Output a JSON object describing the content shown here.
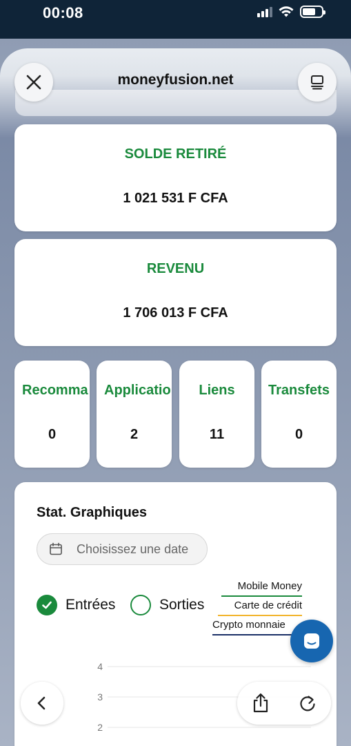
{
  "status_bar": {
    "time": "00:08"
  },
  "browser": {
    "site": "moneyfusion.net",
    "close_icon": "close-icon",
    "tabs_icon": "tab-overview-icon",
    "back_icon": "chevron-left-icon",
    "share_icon": "share-icon",
    "reload_icon": "reload-icon"
  },
  "cards": {
    "solde": {
      "label": "SOLDE RETIRÉ",
      "value": "1 021 531 F CFA"
    },
    "revenu": {
      "label": "REVENU",
      "value": "1 706 013 F CFA"
    }
  },
  "stats": [
    {
      "label": "Recomma",
      "value": "0"
    },
    {
      "label": "Applicatio",
      "value": "2"
    },
    {
      "label": "Liens",
      "value": "11"
    },
    {
      "label": "Transfets",
      "value": "0"
    }
  ],
  "chart_panel": {
    "title": "Stat. Graphiques",
    "date_placeholder": "Choisissez une date",
    "radio_in": "Entrées",
    "radio_out": "Sorties",
    "legend": [
      {
        "name": "Mobile Money",
        "color": "#1a8a3c"
      },
      {
        "name": "Carte de crédit",
        "color": "#f2b42c"
      },
      {
        "name": "Crypto monnaie",
        "color": "#1a2f66"
      }
    ]
  },
  "chart_data": {
    "type": "line",
    "yticks": [
      "4",
      "3",
      "2"
    ],
    "y_visible_range": [
      2,
      4
    ],
    "grid": true
  },
  "colors": {
    "accent": "#1a8a3c",
    "support": "#1766b0"
  }
}
